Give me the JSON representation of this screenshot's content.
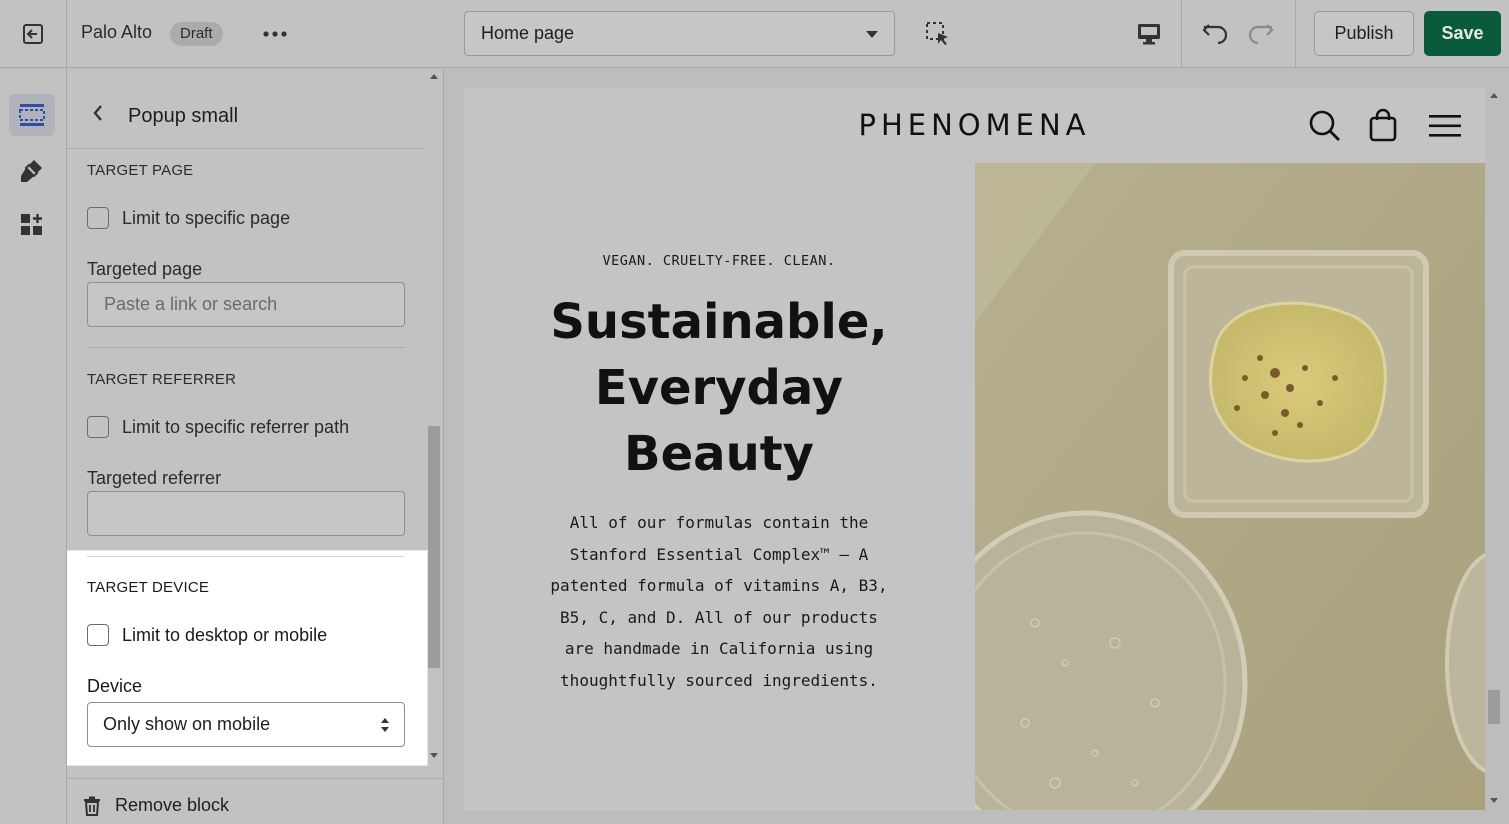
{
  "topbar": {
    "store_name": "Palo Alto",
    "status_badge": "Draft",
    "page_selector": "Home page",
    "publish_label": "Publish",
    "save_label": "Save"
  },
  "sidebar_panel": {
    "title": "Popup small",
    "target_page": {
      "section_label": "TARGET PAGE",
      "checkbox_label": "Limit to specific page",
      "checked": false,
      "field_label": "Targeted page",
      "placeholder": "Paste a link or search"
    },
    "target_referrer": {
      "section_label": "TARGET REFERRER",
      "checkbox_label": "Limit to specific referrer path",
      "checked": false,
      "field_label": "Targeted referrer",
      "value": ""
    },
    "target_device": {
      "section_label": "TARGET DEVICE",
      "checkbox_label": "Limit to desktop or mobile",
      "checked": false,
      "field_label": "Device",
      "selected": "Only show on mobile"
    },
    "remove_label": "Remove block"
  },
  "preview": {
    "brand": "PHENOMENA",
    "eyebrow": "VEGAN. CRUELTY-FREE. CLEAN.",
    "headline_lines": [
      "Sustainable,",
      "Everyday",
      "Beauty"
    ],
    "body_lines": [
      "All of our formulas contain the",
      "Stanford Essential Complex™ – A",
      "patented formula of vitamins A, B3,",
      "B5, C, and D. All of our products",
      "are handmade in California using",
      "thoughtfully sourced ingredients."
    ]
  },
  "colors": {
    "save_button": "#0a5b3c",
    "highlight_panel": "#ffffff",
    "overlay_gray": "#c2c2c2"
  },
  "icons": {
    "exit": "exit-icon",
    "more": "more-icon",
    "inspect": "select-element-icon",
    "device": "desktop-icon",
    "undo": "undo-icon",
    "redo": "redo-icon",
    "sections": "sections-icon",
    "theme_settings": "brush-icon",
    "apps": "apps-icon",
    "back": "chevron-left-icon",
    "trash": "trash-icon",
    "search": "search-icon",
    "bag": "bag-icon",
    "menu": "hamburger-icon"
  }
}
